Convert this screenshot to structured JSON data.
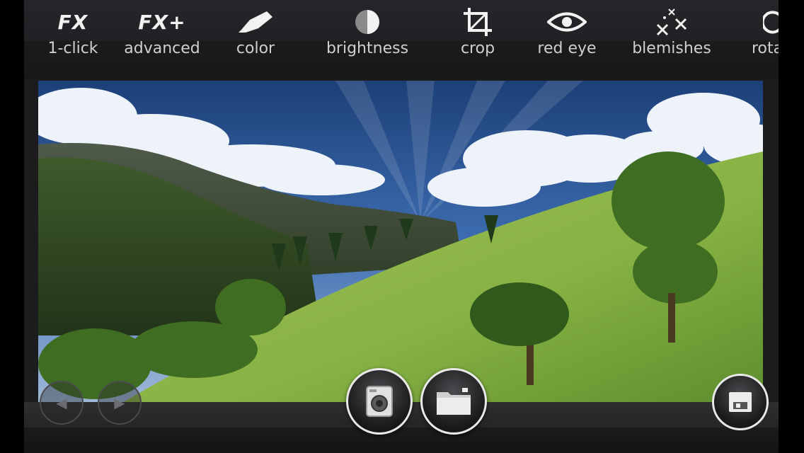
{
  "toolbar": {
    "tools": [
      {
        "icon": "fx",
        "icon_text": "FX",
        "label": "1-click"
      },
      {
        "icon": "fx-plus",
        "icon_text": "FX+",
        "label": "advanced"
      },
      {
        "icon": "pencil-icon",
        "label": "color"
      },
      {
        "icon": "half-circle-icon",
        "label": "brightness"
      },
      {
        "icon": "crop-icon",
        "label": "crop"
      },
      {
        "icon": "eye-icon",
        "label": "red eye"
      },
      {
        "icon": "sparkle-x-icon",
        "label": "blemishes"
      },
      {
        "icon": "rotate-icon",
        "label": "rota"
      }
    ]
  },
  "bottom": {
    "prev_icon": "◀",
    "next_icon": "▶",
    "camera_icon": "camera-icon",
    "folder_icon": "folder-icon",
    "save_icon": "floppy-icon"
  },
  "colors": {
    "toolbar_bg": "#26262a",
    "label": "#cfcfcf",
    "icon": "#f2f2f2",
    "sky": "#2a5690",
    "grass": "#8cb648"
  }
}
